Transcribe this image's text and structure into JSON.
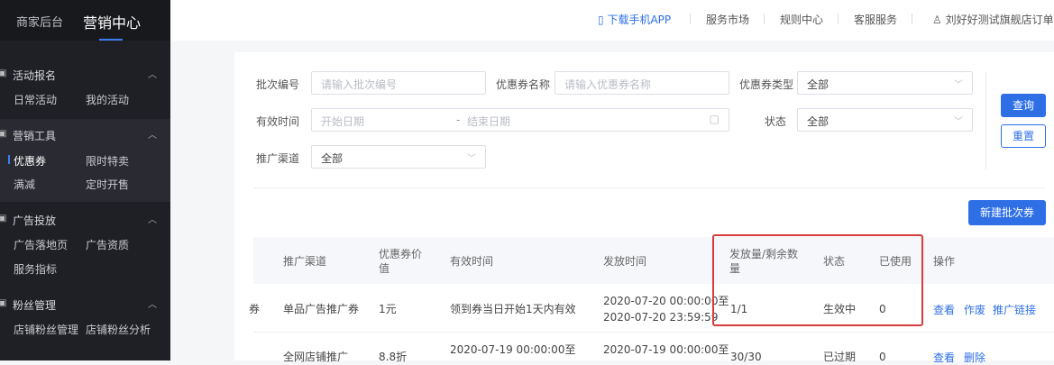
{
  "sidebar": {
    "tabs": [
      "商家后台",
      "营销中心"
    ],
    "groups": [
      {
        "title": "活动报名",
        "items": [
          "日常活动",
          "我的活动"
        ]
      },
      {
        "title": "营销工具",
        "items": [
          "优惠券",
          "限时特卖",
          "满减",
          "定时开售"
        ]
      },
      {
        "title": "广告投放",
        "items": [
          "广告落地页",
          "广告资质",
          "服务指标"
        ]
      },
      {
        "title": "粉丝管理",
        "items": [
          "店铺粉丝管理",
          "店铺粉丝分析"
        ]
      }
    ]
  },
  "topbar": {
    "download_app": "下载手机APP",
    "service_market": "服务市场",
    "rules_center": "规则中心",
    "customer_service": "客服服务",
    "store_name": "刘好好测试旗舰店订单"
  },
  "filters": {
    "batch_no_label": "批次编号",
    "batch_no_placeholder": "请输入批次编号",
    "coupon_name_label": "优惠券名称",
    "coupon_name_placeholder": "请输入优惠券名称",
    "coupon_type_label": "优惠券类型",
    "coupon_type_value": "全部",
    "valid_time_label": "有效时间",
    "start_date_placeholder": "开始日期",
    "date_sep": "-",
    "end_date_placeholder": "结束日期",
    "status_label": "状态",
    "status_value": "全部",
    "channel_label": "推广渠道",
    "channel_value": "全部",
    "query_button": "查询",
    "reset_button": "重置"
  },
  "new_batch_button": "新建批次券",
  "table": {
    "headers": {
      "channel": "推广渠道",
      "value": "优惠券价值",
      "valid_time": "有效时间",
      "issue_time": "发放时间",
      "issued_remaining": "发放量/剩余数量",
      "status": "状态",
      "used": "已使用",
      "actions": "操作"
    },
    "rows": [
      {
        "name_tail": "券",
        "channel": "单品广告推广券",
        "value": "1元",
        "valid_time": "领到券当日开始1天内有效",
        "issue_start": "2020-07-20 00:00:00至",
        "issue_end": "2020-07-20 23:59:59",
        "issued_remaining": "1/1",
        "status": "生效中",
        "used": "0",
        "actions": [
          "查看",
          "作废",
          "推广链接"
        ]
      },
      {
        "channel": "全网店铺推广",
        "value": "8.8折",
        "valid_time": "2020-07-19 00:00:00至",
        "issue_start": "2020-07-19 00:00:00至",
        "issued_remaining": "30/30",
        "status": "已过期",
        "used": "0",
        "actions": [
          "查看",
          "删除"
        ]
      }
    ]
  }
}
